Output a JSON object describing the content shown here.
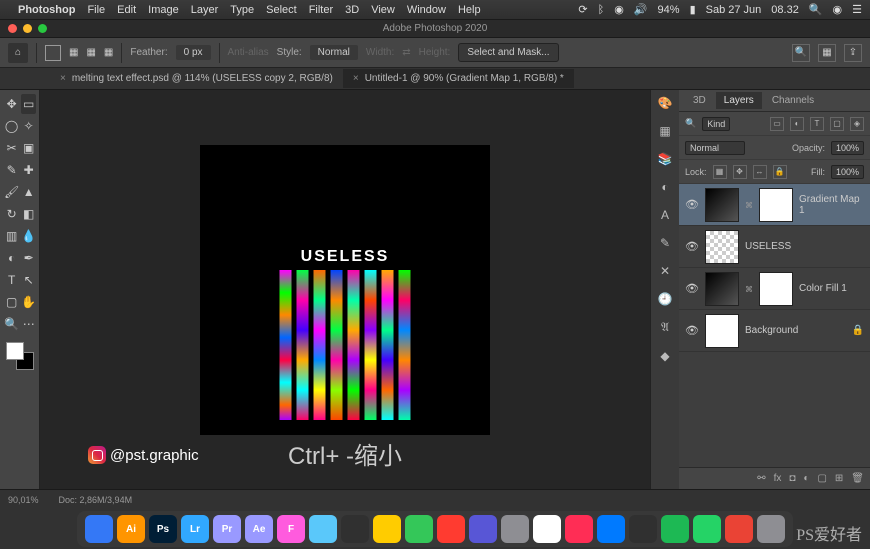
{
  "menubar": {
    "app": "Photoshop",
    "items": [
      "File",
      "Edit",
      "Image",
      "Layer",
      "Type",
      "Select",
      "Filter",
      "3D",
      "View",
      "Window",
      "Help"
    ],
    "right": {
      "battery": "94%",
      "date": "Sab 27 Jun",
      "time": "08.32"
    }
  },
  "titlebar": {
    "title": "Adobe Photoshop 2020"
  },
  "options": {
    "feather_label": "Feather:",
    "feather_val": "0 px",
    "aa": "Anti-alias",
    "style_label": "Style:",
    "style_val": "Normal",
    "width_label": "Width:",
    "height_label": "Height:",
    "mask_btn": "Select and Mask..."
  },
  "tabs": {
    "t1": "melting text effect.psd @ 114% (USELESS copy 2, RGB/8)",
    "t2": "Untitled-1 @ 90% (Gradient Map 1, RGB/8) *"
  },
  "canvas": {
    "text": "USELESS",
    "handle": "@pst.graphic"
  },
  "subtitle": "Ctrl+ -缩小",
  "panels": {
    "tabs": {
      "3d": "3D",
      "layers": "Layers",
      "channels": "Channels"
    },
    "filter": "Kind",
    "blend": "Normal",
    "opacity_l": "Opacity:",
    "opacity_v": "100%",
    "lock_l": "Lock:",
    "fill_l": "Fill:",
    "fill_v": "100%",
    "layers": [
      {
        "name": "Gradient Map 1"
      },
      {
        "name": "USELESS"
      },
      {
        "name": "Color Fill 1"
      },
      {
        "name": "Background"
      }
    ]
  },
  "status": {
    "zoom": "90,01%",
    "doc": "Doc: 2,86M/3,94M"
  },
  "dock_apps": [
    {
      "bg": "#3478f6",
      "t": ""
    },
    {
      "bg": "#ff9500",
      "t": "Ai"
    },
    {
      "bg": "#001e36",
      "t": "Ps"
    },
    {
      "bg": "#31a8ff",
      "t": "Lr"
    },
    {
      "bg": "#9999ff",
      "t": "Pr"
    },
    {
      "bg": "#9999ff",
      "t": "Ae"
    },
    {
      "bg": "#ff5bde",
      "t": "F"
    },
    {
      "bg": "#5ac8fa",
      "t": ""
    },
    {
      "bg": "#303030",
      "t": ""
    },
    {
      "bg": "#ffcc00",
      "t": ""
    },
    {
      "bg": "#34c759",
      "t": ""
    },
    {
      "bg": "#ff3b30",
      "t": ""
    },
    {
      "bg": "#5856d6",
      "t": ""
    },
    {
      "bg": "#8e8e93",
      "t": ""
    },
    {
      "bg": "#ffffff",
      "t": ""
    },
    {
      "bg": "#ff2d55",
      "t": ""
    },
    {
      "bg": "#007aff",
      "t": ""
    },
    {
      "bg": "#303030",
      "t": ""
    },
    {
      "bg": "#1db954",
      "t": ""
    },
    {
      "bg": "#25d366",
      "t": ""
    },
    {
      "bg": "#ea4335",
      "t": ""
    },
    {
      "bg": "#8e8e93",
      "t": ""
    }
  ],
  "watermark": "PS爱好者"
}
